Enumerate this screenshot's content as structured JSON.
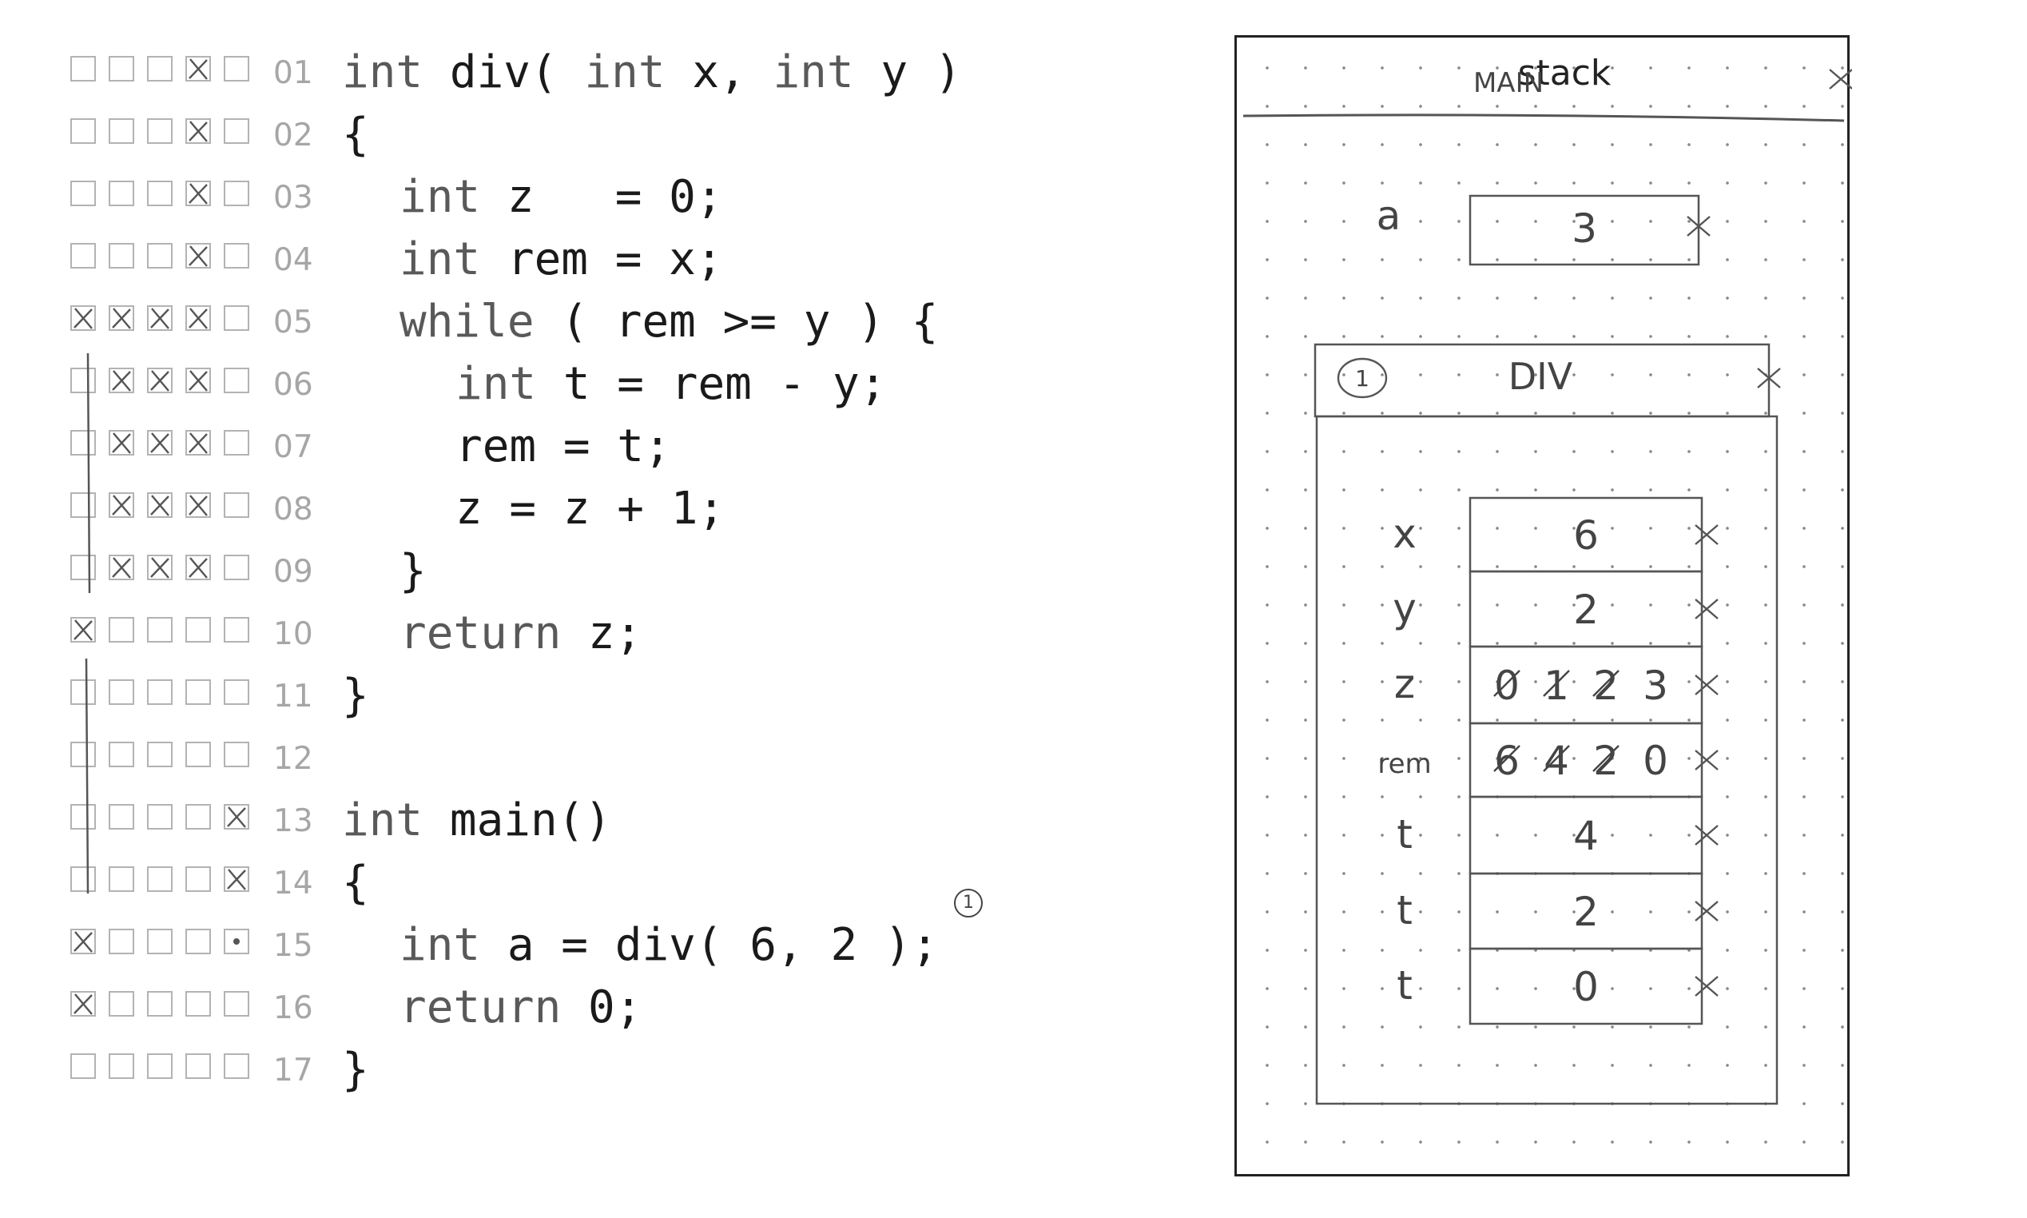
{
  "code_lines": [
    {
      "num": "01",
      "marks": [
        "",
        "",
        "",
        "x",
        ""
      ],
      "indent": 0,
      "parts": [
        {
          "t": "int",
          "k": true
        },
        {
          "t": " div( "
        },
        {
          "t": "int",
          "k": true
        },
        {
          "t": " x, "
        },
        {
          "t": "int",
          "k": true
        },
        {
          "t": " y )"
        }
      ]
    },
    {
      "num": "02",
      "marks": [
        "",
        "",
        "",
        "x",
        ""
      ],
      "indent": 0,
      "parts": [
        {
          "t": "{"
        }
      ]
    },
    {
      "num": "03",
      "marks": [
        "",
        "",
        "",
        "x",
        ""
      ],
      "indent": 1,
      "parts": [
        {
          "t": "int",
          "k": true
        },
        {
          "t": " z   = 0;"
        }
      ]
    },
    {
      "num": "04",
      "marks": [
        "",
        "",
        "",
        "x",
        ""
      ],
      "indent": 1,
      "parts": [
        {
          "t": "int",
          "k": true
        },
        {
          "t": " rem = x;"
        }
      ]
    },
    {
      "num": "05",
      "marks": [
        "x",
        "x",
        "x",
        "x",
        ""
      ],
      "indent": 1,
      "parts": [
        {
          "t": "while",
          "k": true
        },
        {
          "t": " ( rem >= y ) {"
        }
      ]
    },
    {
      "num": "06",
      "marks": [
        "",
        "x",
        "x",
        "x",
        ""
      ],
      "indent": 2,
      "parts": [
        {
          "t": "int",
          "k": true
        },
        {
          "t": " t = rem - y;"
        }
      ]
    },
    {
      "num": "07",
      "marks": [
        "",
        "x",
        "x",
        "x",
        ""
      ],
      "indent": 2,
      "parts": [
        {
          "t": "rem = t;"
        }
      ]
    },
    {
      "num": "08",
      "marks": [
        "",
        "x",
        "x",
        "x",
        ""
      ],
      "indent": 2,
      "parts": [
        {
          "t": "z = z + 1;"
        }
      ]
    },
    {
      "num": "09",
      "marks": [
        "",
        "x",
        "x",
        "x",
        ""
      ],
      "indent": 1,
      "parts": [
        {
          "t": "}"
        }
      ]
    },
    {
      "num": "10",
      "marks": [
        "x",
        "",
        "",
        "",
        ""
      ],
      "indent": 1,
      "parts": [
        {
          "t": "return",
          "k": true
        },
        {
          "t": " z;"
        }
      ]
    },
    {
      "num": "11",
      "marks": [
        "",
        "",
        "",
        "",
        ""
      ],
      "indent": 0,
      "parts": [
        {
          "t": "}"
        }
      ]
    },
    {
      "num": "12",
      "marks": [
        "",
        "",
        "",
        "",
        ""
      ],
      "indent": 0,
      "parts": []
    },
    {
      "num": "13",
      "marks": [
        "",
        "",
        "",
        "",
        "x"
      ],
      "indent": 0,
      "parts": [
        {
          "t": "int",
          "k": true
        },
        {
          "t": " main()"
        }
      ]
    },
    {
      "num": "14",
      "marks": [
        "",
        "",
        "",
        "",
        "x"
      ],
      "indent": 0,
      "parts": [
        {
          "t": "{"
        }
      ]
    },
    {
      "num": "15",
      "marks": [
        "x",
        "",
        "",
        "",
        "dot"
      ],
      "indent": 1,
      "parts": [
        {
          "t": "int",
          "k": true
        },
        {
          "t": " a = div( 6, 2 );"
        }
      ]
    },
    {
      "num": "16",
      "marks": [
        "x",
        "",
        "",
        "",
        ""
      ],
      "indent": 1,
      "parts": [
        {
          "t": "return",
          "k": true
        },
        {
          "t": " 0;"
        }
      ]
    },
    {
      "num": "17",
      "marks": [
        "",
        "",
        "",
        "",
        ""
      ],
      "indent": 0,
      "parts": [
        {
          "t": "}"
        }
      ]
    }
  ],
  "call_annotation": "1",
  "stack": {
    "label": "stack",
    "main_frame": {
      "title": "MAIN",
      "vars": [
        {
          "name": "a",
          "value": "3"
        }
      ]
    },
    "div_frame": {
      "call_id": "1",
      "title": "DIV",
      "vars": [
        {
          "name": "x",
          "values": [
            "6"
          ]
        },
        {
          "name": "y",
          "values": [
            "2"
          ]
        },
        {
          "name": "z",
          "values": [
            "0",
            "1",
            "2",
            "3"
          ]
        },
        {
          "name": "rem",
          "values": [
            "6",
            "4",
            "2",
            "0"
          ]
        },
        {
          "name": "t",
          "values": [
            "4"
          ]
        },
        {
          "name": "t",
          "values": [
            "2"
          ]
        },
        {
          "name": "t",
          "values": [
            "0"
          ]
        }
      ]
    }
  },
  "colors": {
    "text": "#1a1a1a",
    "keyword": "#595959",
    "checkbox": "#b3b3b3",
    "pencil": "#444444"
  }
}
